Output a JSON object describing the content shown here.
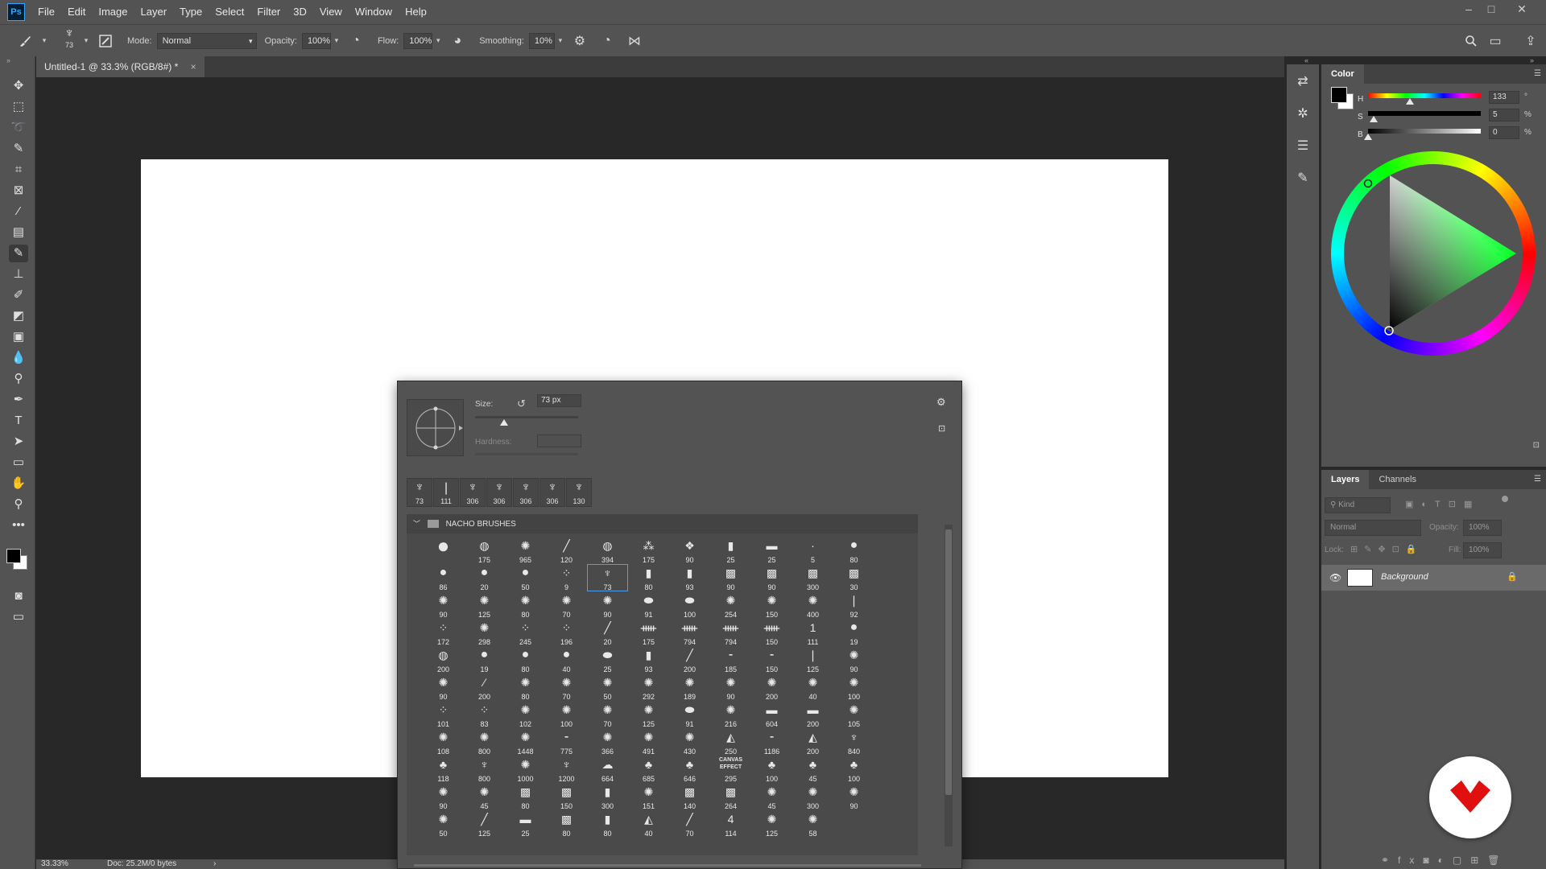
{
  "app": {
    "logo_text": "Ps"
  },
  "menu": [
    "File",
    "Edit",
    "Image",
    "Layer",
    "Type",
    "Select",
    "Filter",
    "3D",
    "View",
    "Window",
    "Help"
  ],
  "window_controls": [
    "–",
    "□",
    "✕"
  ],
  "options_bar": {
    "brush_size_badge": "73",
    "mode_label": "Mode:",
    "mode_value": "Normal",
    "opacity_label": "Opacity:",
    "opacity_value": "100%",
    "flow_label": "Flow:",
    "flow_value": "100%",
    "smoothing_label": "Smoothing:",
    "smoothing_value": "10%"
  },
  "document": {
    "tab_title": "Untitled-1 @ 33.3% (RGB/8#) *",
    "tab_close": "×"
  },
  "status": {
    "zoom": "33.33%",
    "doc_info": "Doc: 25.2M/0 bytes",
    "arrow": "›"
  },
  "brush_picker": {
    "size_label": "Size:",
    "size_value": "73 px",
    "hardness_label": "Hardness:",
    "size_fraction": 0.28,
    "recent": [
      {
        "glyph": "♆",
        "num": "73"
      },
      {
        "glyph": "❘",
        "num": "111"
      },
      {
        "glyph": "♆",
        "num": "306"
      },
      {
        "glyph": "♆",
        "num": "306"
      },
      {
        "glyph": "♆",
        "num": "306"
      },
      {
        "glyph": "♆",
        "num": "306"
      },
      {
        "glyph": "♆",
        "num": "130"
      }
    ],
    "group_name": "NACHO BRUSHES",
    "selected_index": 15,
    "brushes": [
      {
        "g": "●",
        "n": ""
      },
      {
        "g": "◍",
        "n": "175"
      },
      {
        "g": "✺",
        "n": "965"
      },
      {
        "g": "╱",
        "n": "120"
      },
      {
        "g": "◍",
        "n": "394"
      },
      {
        "g": "⁂",
        "n": "175"
      },
      {
        "g": "❖",
        "n": "90"
      },
      {
        "g": "▮",
        "n": "25"
      },
      {
        "g": "▬",
        "n": "25"
      },
      {
        "g": "·",
        "n": "5"
      },
      {
        "g": "●",
        "n": "80"
      },
      {
        "g": "●",
        "n": "86"
      },
      {
        "g": "●",
        "n": "20"
      },
      {
        "g": "●",
        "n": "50"
      },
      {
        "g": "⁘",
        "n": "9"
      },
      {
        "g": "♆",
        "n": "73"
      },
      {
        "g": "▮",
        "n": "80"
      },
      {
        "g": "▮",
        "n": "93"
      },
      {
        "g": "▩",
        "n": "90"
      },
      {
        "g": "▩",
        "n": "90"
      },
      {
        "g": "▩",
        "n": "300"
      },
      {
        "g": "▩",
        "n": "30"
      },
      {
        "g": "✺",
        "n": "90"
      },
      {
        "g": "✺",
        "n": "125"
      },
      {
        "g": "✺",
        "n": "80"
      },
      {
        "g": "✺",
        "n": "70"
      },
      {
        "g": "✺",
        "n": "90"
      },
      {
        "g": "⬬",
        "n": "91"
      },
      {
        "g": "⬬",
        "n": "100"
      },
      {
        "g": "✺",
        "n": "254"
      },
      {
        "g": "✺",
        "n": "150"
      },
      {
        "g": "✺",
        "n": "400"
      },
      {
        "g": "❘",
        "n": "92"
      },
      {
        "g": "⁘",
        "n": "172"
      },
      {
        "g": "✺",
        "n": "298"
      },
      {
        "g": "⁘",
        "n": "245"
      },
      {
        "g": "⁘",
        "n": "196"
      },
      {
        "g": "╱",
        "n": "20"
      },
      {
        "g": "ᚔ",
        "n": "175"
      },
      {
        "g": "ᚔ",
        "n": "794"
      },
      {
        "g": "ᚔ",
        "n": "794"
      },
      {
        "g": "ᚔ",
        "n": "150"
      },
      {
        "g": "1",
        "n": "111"
      },
      {
        "g": "●",
        "n": "19"
      },
      {
        "g": "◍",
        "n": "200"
      },
      {
        "g": "●",
        "n": "19"
      },
      {
        "g": "●",
        "n": "80"
      },
      {
        "g": "●",
        "n": "40"
      },
      {
        "g": "⬬",
        "n": "25"
      },
      {
        "g": "▮",
        "n": "93"
      },
      {
        "g": "╱",
        "n": "200"
      },
      {
        "g": "⁃",
        "n": "185"
      },
      {
        "g": "⁃",
        "n": "150"
      },
      {
        "g": "❘",
        "n": "125"
      },
      {
        "g": "✺",
        "n": "90"
      },
      {
        "g": "✺",
        "n": "90"
      },
      {
        "g": "⁄",
        "n": "200"
      },
      {
        "g": "✺",
        "n": "80"
      },
      {
        "g": "✺",
        "n": "70"
      },
      {
        "g": "✺",
        "n": "50"
      },
      {
        "g": "✺",
        "n": "292"
      },
      {
        "g": "✺",
        "n": "189"
      },
      {
        "g": "✺",
        "n": "90"
      },
      {
        "g": "✺",
        "n": "200"
      },
      {
        "g": "✺",
        "n": "40"
      },
      {
        "g": "✺",
        "n": "100"
      },
      {
        "g": "⁘",
        "n": "101"
      },
      {
        "g": "⁘",
        "n": "83"
      },
      {
        "g": "✺",
        "n": "102"
      },
      {
        "g": "✺",
        "n": "100"
      },
      {
        "g": "✺",
        "n": "70"
      },
      {
        "g": "✺",
        "n": "125"
      },
      {
        "g": "⬬",
        "n": "91"
      },
      {
        "g": "✺",
        "n": "216"
      },
      {
        "g": "▬",
        "n": "604"
      },
      {
        "g": "▬",
        "n": "200"
      },
      {
        "g": "✺",
        "n": "105"
      },
      {
        "g": "✺",
        "n": "108"
      },
      {
        "g": "✺",
        "n": "800"
      },
      {
        "g": "✺",
        "n": "1448"
      },
      {
        "g": "⁃",
        "n": "775"
      },
      {
        "g": "✺",
        "n": "366"
      },
      {
        "g": "✺",
        "n": "491"
      },
      {
        "g": "✺",
        "n": "430"
      },
      {
        "g": "◭",
        "n": "250"
      },
      {
        "g": "⁃",
        "n": "1186"
      },
      {
        "g": "◭",
        "n": "200"
      },
      {
        "g": "♆",
        "n": "840"
      },
      {
        "g": "♣",
        "n": "118"
      },
      {
        "g": "♆",
        "n": "800"
      },
      {
        "g": "✺",
        "n": "1000"
      },
      {
        "g": "♆",
        "n": "1200"
      },
      {
        "g": "☁",
        "n": "664"
      },
      {
        "g": "♣",
        "n": "685"
      },
      {
        "g": "♣",
        "n": "646"
      },
      {
        "g": "CANVAS EFFECT",
        "n": "295"
      },
      {
        "g": "♣",
        "n": "100"
      },
      {
        "g": "♣",
        "n": "45"
      },
      {
        "g": "♣",
        "n": "100"
      },
      {
        "g": "✺",
        "n": "90"
      },
      {
        "g": "✺",
        "n": "45"
      },
      {
        "g": "▩",
        "n": "80"
      },
      {
        "g": "▩",
        "n": "150"
      },
      {
        "g": "▮",
        "n": "300"
      },
      {
        "g": "✺",
        "n": "151"
      },
      {
        "g": "▩",
        "n": "140"
      },
      {
        "g": "▩",
        "n": "264"
      },
      {
        "g": "✺",
        "n": "45"
      },
      {
        "g": "✺",
        "n": "300"
      },
      {
        "g": "✺",
        "n": "90"
      },
      {
        "g": "✺",
        "n": "50"
      },
      {
        "g": "╱",
        "n": "125"
      },
      {
        "g": "▬",
        "n": "25"
      },
      {
        "g": "▩",
        "n": "80"
      },
      {
        "g": "▮",
        "n": "80"
      },
      {
        "g": "◭",
        "n": "40"
      },
      {
        "g": "╱",
        "n": "70"
      },
      {
        "g": "4",
        "n": "114"
      },
      {
        "g": "✺",
        "n": "125"
      },
      {
        "g": "✺",
        "n": "58"
      }
    ]
  },
  "color_panel": {
    "tab": "Color",
    "h_label": "H",
    "h_value": "133",
    "h_unit": "°",
    "s_label": "S",
    "s_value": "5",
    "s_unit": "%",
    "b_label": "B",
    "b_value": "0",
    "b_unit": "%",
    "h_fraction": 0.369,
    "s_fraction": 0.05,
    "b_fraction": 0.0
  },
  "layers_panel": {
    "tabs": [
      "Layers",
      "Channels"
    ],
    "kind_placeholder": "Kind",
    "blend_mode": "Normal",
    "opacity_label": "Opacity:",
    "opacity_value": "100%",
    "lock_label": "Lock:",
    "fill_label": "Fill:",
    "fill_value": "100%",
    "layer_name": "Background"
  },
  "colors": {
    "accent": "#31a8ff",
    "selection": "#4d9ee8",
    "logo_red": "#e01010"
  }
}
